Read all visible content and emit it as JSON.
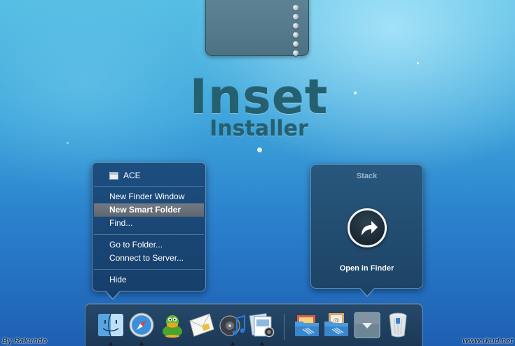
{
  "title": {
    "main": "Inset",
    "sub": "Installer"
  },
  "context_menu": {
    "header": "ACE",
    "items": [
      {
        "label": "New Finder Window",
        "highlighted": false
      },
      {
        "label": "New Smart Folder",
        "highlighted": true
      },
      {
        "label": "Find...",
        "highlighted": false
      },
      {
        "label": "Go to Folder...",
        "highlighted": false
      },
      {
        "label": "Connect to Server...",
        "highlighted": false
      },
      {
        "label": "Hide",
        "highlighted": false
      }
    ]
  },
  "stack_popup": {
    "title": "Stack",
    "action_label": "Open in Finder",
    "action_icon": "curved-arrow-icon"
  },
  "dock": {
    "items": [
      {
        "icon": "finder-icon",
        "running": true
      },
      {
        "icon": "safari-icon",
        "running": true
      },
      {
        "icon": "adium-duck-icon",
        "running": false
      },
      {
        "icon": "mail-icon",
        "running": false
      },
      {
        "icon": "itunes-icon",
        "running": true
      },
      {
        "icon": "preview-icon",
        "running": true
      },
      {
        "icon": "applications-folder-icon",
        "running": false
      },
      {
        "icon": "documents-folder-icon",
        "running": false
      },
      {
        "icon": "stack-toggle-icon",
        "running": false
      },
      {
        "icon": "trash-icon",
        "running": false
      }
    ]
  },
  "credits": {
    "left": "By Rakundo",
    "right": "www.rkud.net"
  },
  "colors": {
    "menu_highlight": "#6a727b",
    "menu_bg": "#1a4676",
    "title": "#24606f"
  }
}
